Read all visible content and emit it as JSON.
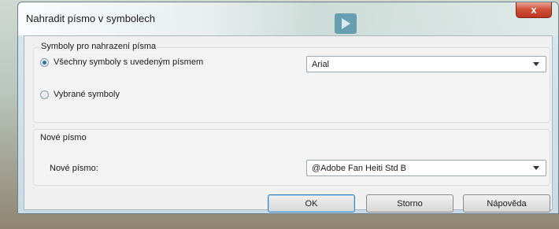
{
  "window": {
    "title": "Nahradit písmo v symbolech",
    "close_glyph": "x"
  },
  "group_symbols": {
    "title": "Symboly pro nahrazení písma",
    "radio_all_label": "Všechny symboly s uvedeným písmem",
    "radio_all_checked": true,
    "radio_selected_label": "Vybrané symboly",
    "radio_selected_checked": false,
    "font_select_value": "Arial"
  },
  "group_new_font": {
    "title": "Nové písmo",
    "field_label": "Nové písmo:",
    "font_select_value": "@Adobe Fan Heiti Std B"
  },
  "buttons": {
    "ok": "OK",
    "cancel": "Storno",
    "help": "Nápověda"
  },
  "colors": {
    "close_button": "#c0361f",
    "default_button_border": "#3c7fb1",
    "radio_checked": "#2d6fb0"
  }
}
